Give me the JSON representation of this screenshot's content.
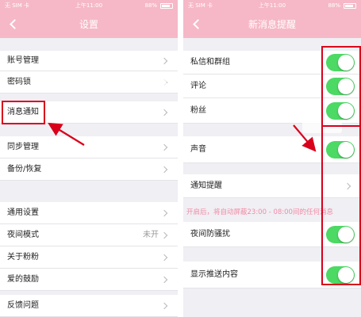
{
  "status_bar": {
    "carrier": "无 SIM 卡",
    "time": "上午11:00",
    "battery": "88%"
  },
  "left_screen": {
    "title": "设置",
    "items": [
      {
        "label": "账号管理"
      },
      {
        "label": "密码锁"
      },
      {
        "label": "消息通知"
      },
      {
        "label": "同步管理"
      },
      {
        "label": "备份/恢复"
      },
      {
        "label": "通用设置"
      },
      {
        "label": "夜间模式"
      },
      {
        "label": "关于粉粉"
      },
      {
        "label": "爱的鼓励"
      },
      {
        "label": "反馈问题"
      }
    ],
    "night_mode_value": "未开"
  },
  "right_screen": {
    "title": "新消息提醒",
    "items": [
      {
        "label": "私信和群组",
        "on": true
      },
      {
        "label": "评论",
        "on": true
      },
      {
        "label": "粉丝",
        "on": true
      },
      {
        "label": "声音",
        "on": true
      },
      {
        "label": "通知提醒",
        "on": null
      },
      {
        "label": "夜间防骚扰",
        "on": true
      },
      {
        "label": "显示推送内容",
        "on": true
      }
    ],
    "hint": "开启后，将自动屏蔽23:00 - 08:00间的任何消息"
  },
  "colors": {
    "header": "#f6b8c6",
    "toggle_on": "#4cd964",
    "annotation": "#d9001b",
    "hint_text": "#f38aa3"
  }
}
